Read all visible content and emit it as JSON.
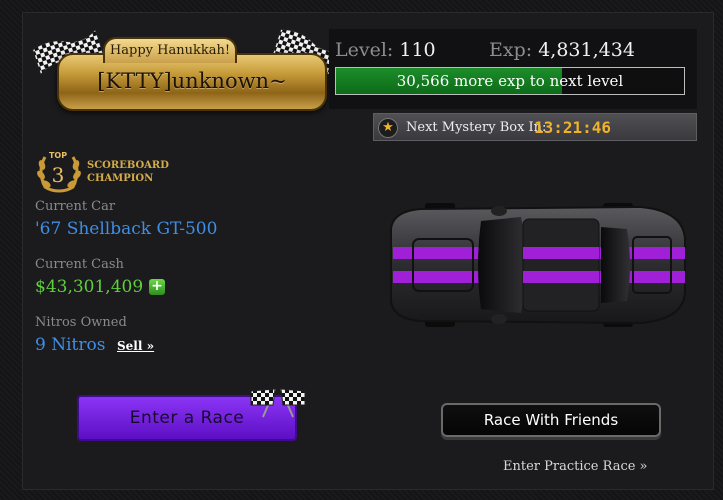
{
  "player": {
    "greeting": "Happy Hanukkah!",
    "username": "[KTTY]unknown~"
  },
  "level": {
    "level_label": "Level:",
    "level_value": "110",
    "exp_label": "Exp:",
    "exp_value": "4,831,434",
    "progress_text": "30,566 more exp to next level",
    "progress_fraction": 0.65
  },
  "mystery_box": {
    "label": "Next Mystery Box In:",
    "timer": "13:21:46"
  },
  "badge": {
    "top_label": "TOP",
    "rank": "3",
    "line1": "SCOREBOARD",
    "line2": "CHAMPION"
  },
  "stats": {
    "car_label": "Current Car",
    "car_value": "'67 Shellback GT-500",
    "cash_label": "Current Cash",
    "cash_value": "$43,301,409",
    "nitros_label": "Nitros Owned",
    "nitros_value": "9 Nitros",
    "sell_label": "Sell »"
  },
  "actions": {
    "enter_race": "Enter a Race",
    "race_friends": "Race With Friends",
    "practice": "Enter Practice Race »"
  },
  "colors": {
    "accent_gold": "#f0b229",
    "car_stripe": "#a020d8",
    "link_blue": "#3f8ee6",
    "cash_green": "#5fcf3a",
    "progress_green": "#1d8d2a",
    "race_button_purple": "#7a2ae8"
  },
  "icons": {
    "star": "star-icon",
    "checkered_flags": "checkered-flags-icon",
    "laurel": "laurel-icon",
    "plus": "plus-icon"
  }
}
